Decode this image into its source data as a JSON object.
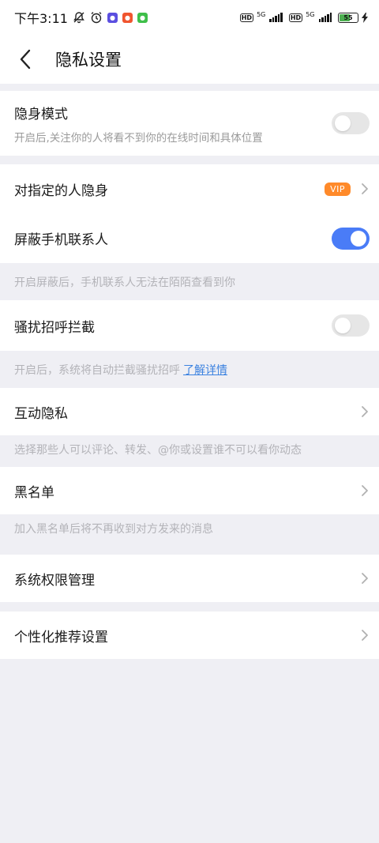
{
  "status_bar": {
    "time": "下午3:11",
    "network_1": "5G",
    "network_2": "5G",
    "hd_1": "HD",
    "hd_2": "HD",
    "battery_percent": "55",
    "battery_level": 0.55,
    "icons": [
      "mute-bell-icon",
      "alarm-icon",
      "app-notification-icon",
      "app-notification-icon",
      "app-notification-icon",
      "signal-icon",
      "battery-icon",
      "charging-icon"
    ]
  },
  "header": {
    "title": "隐私设置"
  },
  "sections": {
    "stealth": {
      "label": "隐身模式",
      "description": "开启后,关注你的人将看不到你的在线时间和具体位置",
      "toggle_on": false
    },
    "hide_specific": {
      "label": "对指定的人隐身",
      "badge": "VIP"
    },
    "block_contacts": {
      "label": "屏蔽手机联系人",
      "toggle_on": true,
      "note": "开启屏蔽后，手机联系人无法在陌陌查看到你"
    },
    "harassment": {
      "label": "骚扰招呼拦截",
      "toggle_on": false,
      "note": "开启后，系统将自动拦截骚扰招呼",
      "link": "了解详情"
    },
    "interaction": {
      "label": "互动隐私",
      "note": "选择那些人可以评论、转发、@你或设置谁不可以看你动态"
    },
    "blacklist": {
      "label": "黑名单",
      "note": "加入黑名单后将不再收到对方发来的消息"
    },
    "permissions": {
      "label": "系统权限管理"
    },
    "recommend": {
      "label": "个性化推荐设置"
    }
  },
  "colors": {
    "accent": "#4a7cf7",
    "vip": "#ff8a2a",
    "link": "#3b82e0",
    "background": "#efeff4"
  }
}
